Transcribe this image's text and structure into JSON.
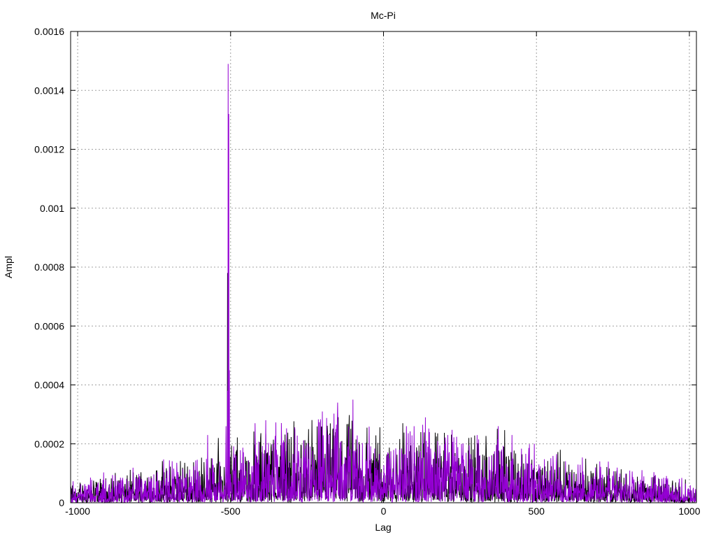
{
  "chart_data": {
    "type": "line",
    "title": "Mc-Pi",
    "xlabel": "Lag",
    "ylabel": "Ampl",
    "xlim": [
      -1023,
      1023
    ],
    "ylim": [
      0,
      0.0016
    ],
    "xticks": [
      -1000,
      -500,
      0,
      500,
      1000
    ],
    "xtick_labels": [
      "-1000",
      "-500",
      "0",
      "500",
      "1000"
    ],
    "yticks": [
      0,
      0.0002,
      0.0004,
      0.0006,
      0.0008,
      0.001,
      0.0012,
      0.0014,
      0.0016
    ],
    "ytick_labels": [
      "0",
      "0.0002",
      "0.0004",
      "0.0006",
      "0.0008",
      "0.001",
      "0.0012",
      "0.0014",
      "0.0016"
    ],
    "grid": true,
    "series": [
      {
        "name": "series-black",
        "color": "#000000",
        "noise_envelope": {
          "lags": [
            -1023,
            -800,
            -600,
            -400,
            -200,
            0,
            200,
            400,
            600,
            800,
            1023
          ],
          "levels": [
            3e-05,
            5e-05,
            7e-05,
            0.00011,
            0.00013,
            0.00012,
            0.00011,
            0.0001,
            7e-05,
            5e-05,
            3e-05
          ]
        },
        "peaks": [
          {
            "lag": -510,
            "value": 0.00078
          },
          {
            "lag": -506,
            "value": 0.00045
          },
          {
            "lag": -540,
            "value": 0.00022
          }
        ]
      },
      {
        "name": "series-purple",
        "color": "#9400d3",
        "noise_envelope": {
          "lags": [
            -1023,
            -800,
            -600,
            -400,
            -200,
            0,
            200,
            400,
            600,
            800,
            1023
          ],
          "levels": [
            3e-05,
            5e-05,
            7e-05,
            0.00011,
            0.00013,
            0.00012,
            0.00011,
            0.0001,
            7e-05,
            5e-05,
            3e-05
          ]
        },
        "peaks": [
          {
            "lag": -508,
            "value": 0.00149
          },
          {
            "lag": -506,
            "value": 0.00132
          },
          {
            "lag": -510,
            "value": 0.00038
          },
          {
            "lag": -504,
            "value": 0.00045
          },
          {
            "lag": -515,
            "value": 0.00026
          },
          {
            "lag": -385,
            "value": 0.00028
          },
          {
            "lag": -150,
            "value": 0.00034
          },
          {
            "lag": -100,
            "value": 0.00035
          },
          {
            "lag": -420,
            "value": 0.00027
          },
          {
            "lag": 75,
            "value": 0.00026
          },
          {
            "lag": 100,
            "value": 0.00026
          },
          {
            "lag": 375,
            "value": 0.00026
          },
          {
            "lag": 210,
            "value": 0.00023
          },
          {
            "lag": 420,
            "value": 0.00023
          },
          {
            "lag": -575,
            "value": 0.00023
          }
        ]
      }
    ]
  }
}
